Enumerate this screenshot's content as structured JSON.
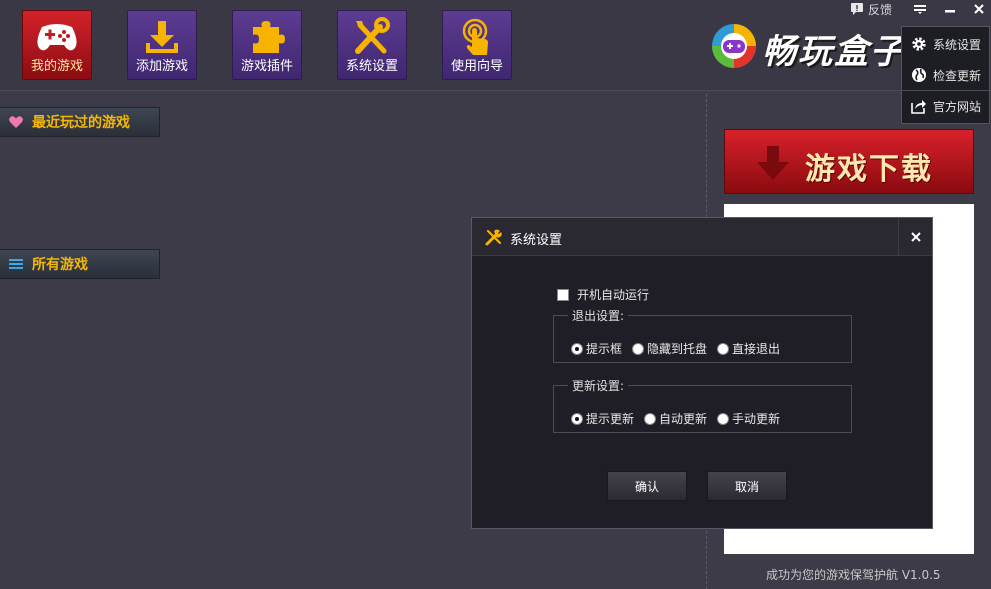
{
  "toolbar": {
    "my_games": "我的游戏",
    "add_game": "添加游戏",
    "plugins": "游戏插件",
    "settings": "系统设置",
    "guide": "使用向导"
  },
  "brand": {
    "name": "畅玩盒子"
  },
  "header": {
    "feedback": "反馈",
    "menu": [
      {
        "label": "系统设置",
        "icon": "gear-icon"
      },
      {
        "label": "检查更新",
        "icon": "globe-icon"
      },
      {
        "label": "官方网站",
        "icon": "share-icon"
      }
    ]
  },
  "sections": {
    "recent": "最近玩过的游戏",
    "all": "所有游戏"
  },
  "banner": {
    "label": "游戏下载"
  },
  "footer": {
    "slogan": "成功为您的游戏保驾护航   V1.0.5"
  },
  "dialog": {
    "title": "系统设置",
    "autostart_label": "开机自动运行",
    "autostart_checked": false,
    "exit_group": {
      "legend": "退出设置:",
      "options": [
        "提示框",
        "隐藏到托盘",
        "直接退出"
      ],
      "selected": 0
    },
    "update_group": {
      "legend": "更新设置:",
      "options": [
        "提示更新",
        "自动更新",
        "手动更新"
      ],
      "selected": 0
    },
    "ok": "确认",
    "cancel": "取消"
  },
  "colors": {
    "background": "#3d3b48",
    "toolbar_purple": "#4e3282",
    "toolbar_active": "#c41a22",
    "section_text": "#f5b700",
    "banner_red": "#c81b23"
  }
}
